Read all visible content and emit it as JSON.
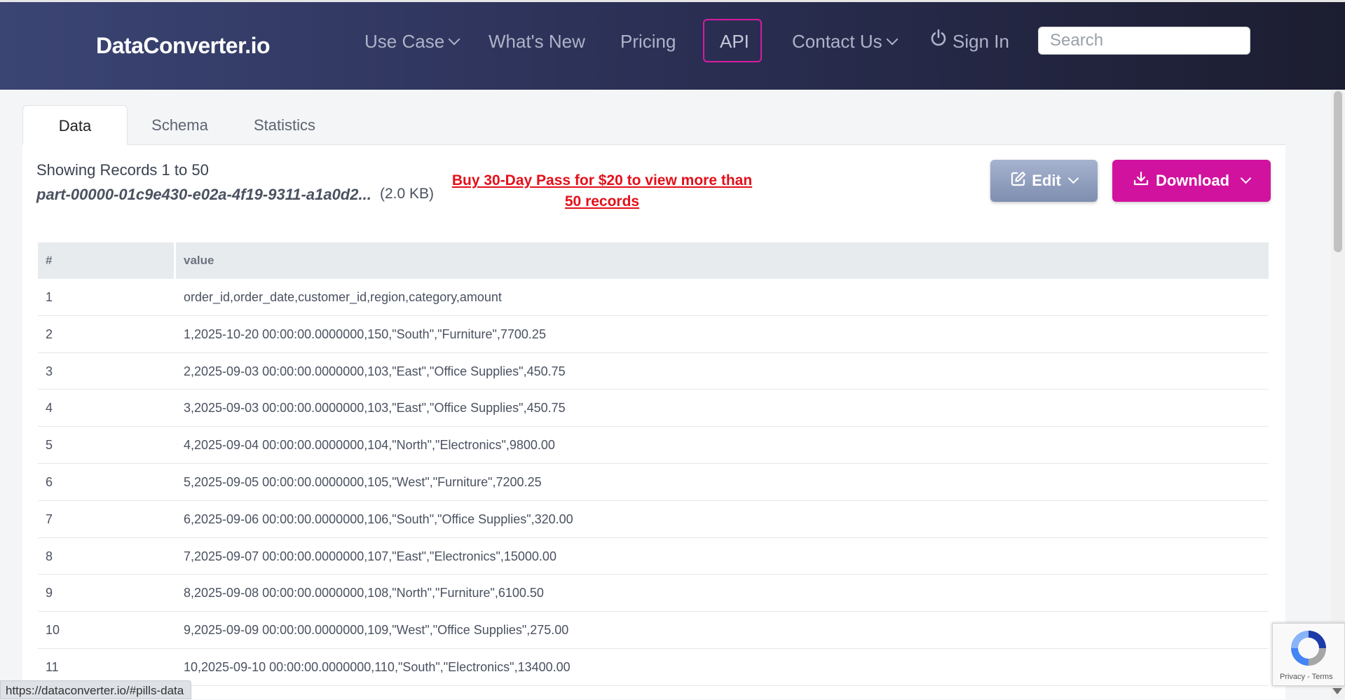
{
  "header": {
    "brand": "DataConverter.io",
    "nav": {
      "use_case": "Use Case",
      "whats_new": "What's New",
      "pricing": "Pricing",
      "api": "API",
      "contact_us": "Contact Us",
      "sign_in": "Sign In"
    },
    "search_placeholder": "Search"
  },
  "tabs": [
    "Data",
    "Schema",
    "Statistics"
  ],
  "info": {
    "records": "Showing Records 1 to 50",
    "filename": "part-00000-01c9e430-e02a-4f19-9311-a1a0d2...",
    "filesize": "(2.0 KB)",
    "promo": "Buy 30-Day Pass for $20 to view more than 50 records"
  },
  "buttons": {
    "edit": "Edit",
    "download": "Download"
  },
  "table": {
    "columns": [
      "#",
      "value"
    ],
    "rows": [
      [
        "1",
        "order_id,order_date,customer_id,region,category,amount"
      ],
      [
        "2",
        "1,2025-10-20 00:00:00.0000000,150,\"South\",\"Furniture\",7700.25"
      ],
      [
        "3",
        "2,2025-09-03 00:00:00.0000000,103,\"East\",\"Office Supplies\",450.75"
      ],
      [
        "4",
        "3,2025-09-03 00:00:00.0000000,103,\"East\",\"Office Supplies\",450.75"
      ],
      [
        "5",
        "4,2025-09-04 00:00:00.0000000,104,\"North\",\"Electronics\",9800.00"
      ],
      [
        "6",
        "5,2025-09-05 00:00:00.0000000,105,\"West\",\"Furniture\",7200.25"
      ],
      [
        "7",
        "6,2025-09-06 00:00:00.0000000,106,\"South\",\"Office Supplies\",320.00"
      ],
      [
        "8",
        "7,2025-09-07 00:00:00.0000000,107,\"East\",\"Electronics\",15000.00"
      ],
      [
        "9",
        "8,2025-09-08 00:00:00.0000000,108,\"North\",\"Furniture\",6100.50"
      ],
      [
        "10",
        "9,2025-09-09 00:00:00.0000000,109,\"West\",\"Office Supplies\",275.00"
      ],
      [
        "11",
        "10,2025-09-10 00:00:00.0000000,110,\"South\",\"Electronics\",13400.00"
      ]
    ]
  },
  "status_url": "https://dataconverter.io/#pills-data",
  "recaptcha": {
    "privacy": "Privacy",
    "sep": " - ",
    "terms": "Terms"
  },
  "colors": {
    "accent": "#d1129e",
    "promo": "#e3101a",
    "header_start": "#3b4574",
    "header_end": "#1c1d30"
  }
}
